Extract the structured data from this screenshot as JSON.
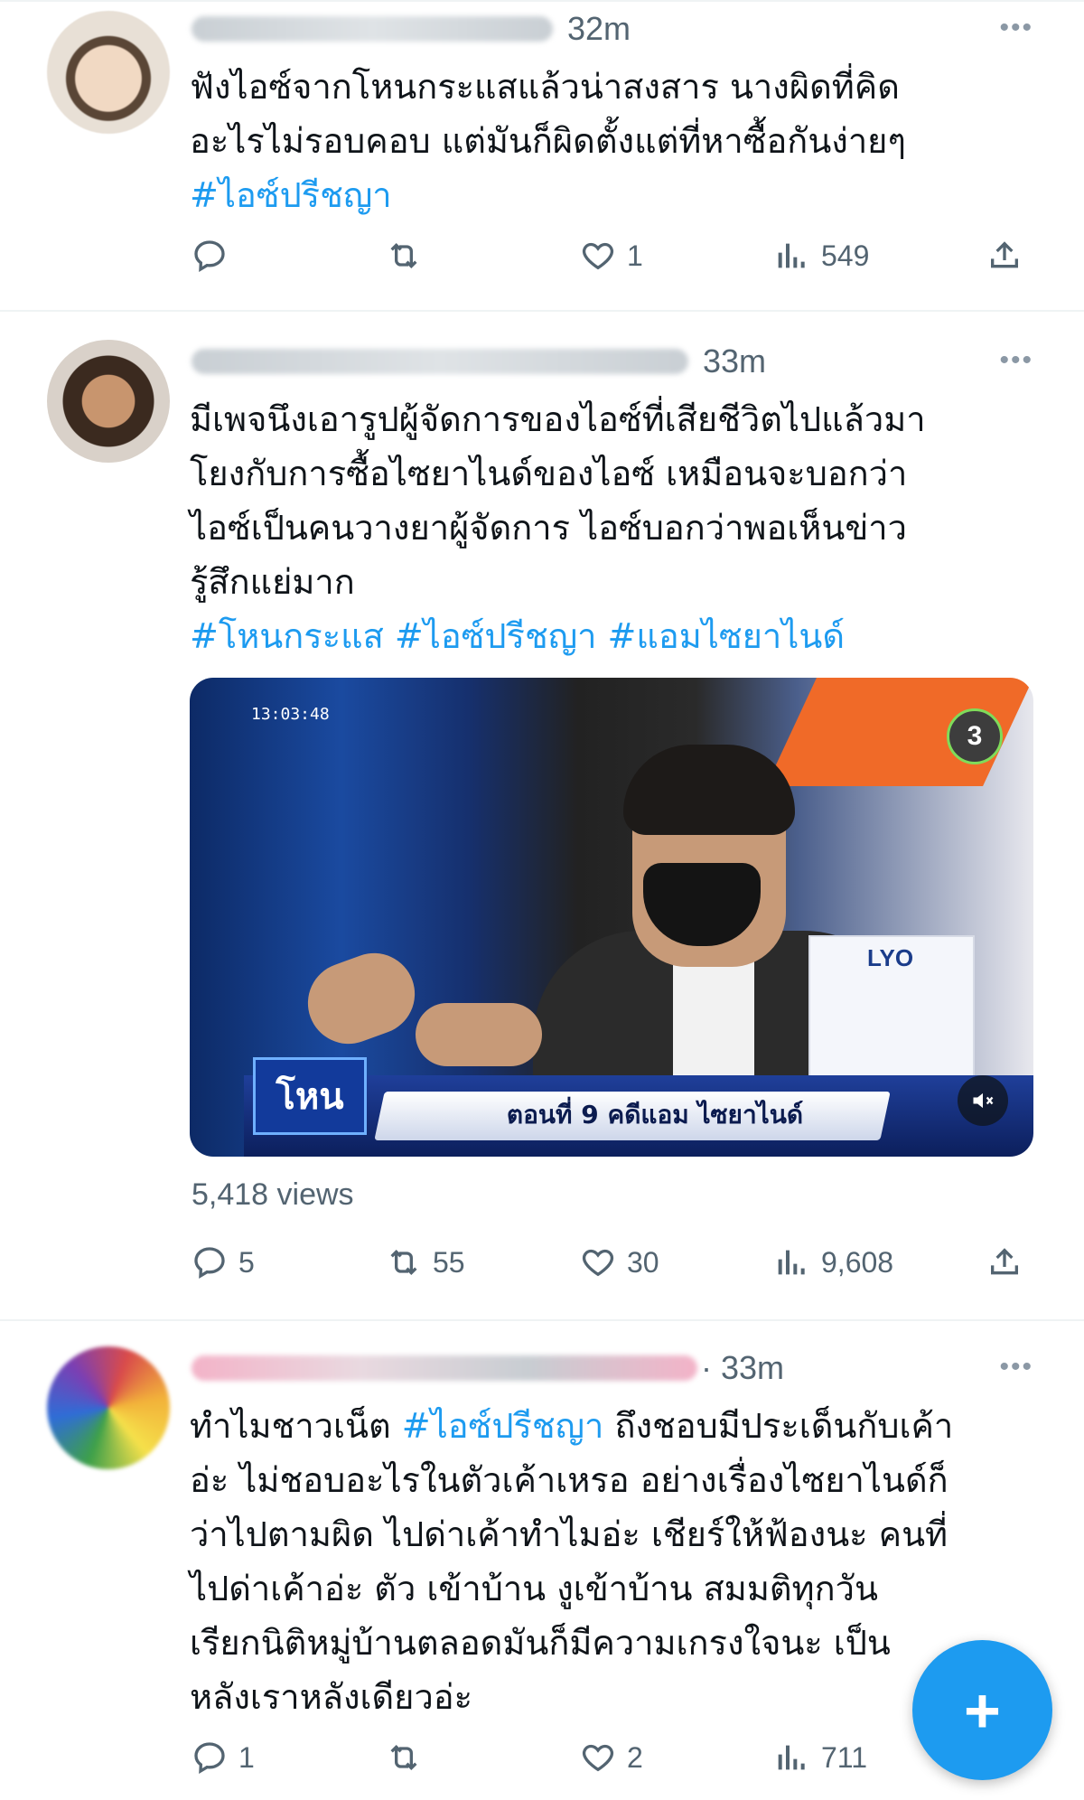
{
  "feed": {
    "tweets": [
      {
        "time": "32m",
        "more": "•••",
        "lines": [
          "ฟังไอซ์จากโหนกระแสแล้วน่าสงสาร นางผิดที่คิด",
          "อะไรไม่รอบคอบ  แต่มันก็ผิดตั้งแต่ที่หาซื้อกันง่ายๆ"
        ],
        "hashtags": "#ไอซ์ปรีชญา",
        "replies": "",
        "retweets": "",
        "likes": "1",
        "views": "549"
      },
      {
        "time": "33m",
        "more": "•••",
        "lines": [
          "มีเพจนึงเอารูปผู้จัดการของไอซ์ที่เสียชีวิตไปแล้วมา",
          "โยงกับการซื้อไซยาไนด์ของไอซ์ เหมือนจะบอกว่า",
          "ไอซ์เป็นคนวางยาผู้จัดการ ไอซ์บอกว่าพอเห็นข่าว",
          "รู้สึกแย่มาก"
        ],
        "hashtags": "#โหนกระแส #ไอซ์ปรีชญา #แอมไซยาไนด์",
        "media": {
          "timestamp": "13:03:48",
          "channel": "3",
          "show_logo": "โหน",
          "caption": "ตอนที่ 9 คดีแอม ไซยาไนด์",
          "product_label": "LYO"
        },
        "view_count_text": "5,418 views",
        "replies": "5",
        "retweets": "55",
        "likes": "30",
        "views": "9,608"
      },
      {
        "time": "· 33m",
        "more": "•••",
        "line1_before": "ทำไมชาวเน็ต ",
        "line1_hashtag": "#ไอซ์ปรีชญา",
        "line1_after": " ถึงชอบมีประเด็นกับเค้า",
        "lines": [
          "อ่ะ ไม่ชอบอะไรในตัวเค้าเหรอ อย่างเรื่องไซยาไนด์ก็",
          "ว่าไปตามผิด ไปด่าเค้าทำไมอ่ะ เชียร์ให้ฟ้องนะ คนที่",
          "ไปด่าเค้าอ่ะ ตัว   เข้าบ้าน งูเข้าบ้าน สมมติทุกวัน",
          "เรียกนิติหมู่บ้านตลอดมันก็มีความเกรงใจนะ เป็น",
          "หลังเราหลังเดียวอ่ะ"
        ],
        "replies": "1",
        "retweets": "",
        "likes": "2",
        "views": "711"
      }
    ]
  },
  "fab": {
    "label": "+"
  },
  "colors": {
    "accent": "#1d9bf0",
    "muted": "#536471",
    "divider": "#eff3f4"
  },
  "icons": [
    "reply-icon",
    "retweet-icon",
    "like-icon",
    "views-icon",
    "share-icon",
    "more-icon",
    "mute-icon",
    "plus-icon"
  ]
}
